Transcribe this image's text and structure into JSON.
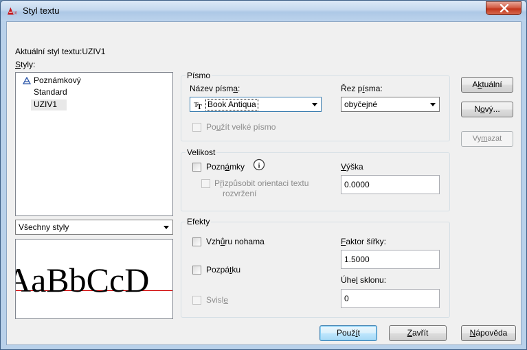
{
  "window": {
    "title": "Styl textu",
    "app_icon_text": "A10"
  },
  "current_style": {
    "label": "Aktuální styl textu:",
    "value": "UZIV1"
  },
  "styles": {
    "label": "Styly:",
    "items": [
      {
        "label": "Poznámkový",
        "annotative": true
      },
      {
        "label": "Standard",
        "annotative": false
      },
      {
        "label": "UZIV1",
        "annotative": false,
        "selected": true
      }
    ],
    "filter_value": "Všechny styly",
    "preview_text": "AaBbCcD"
  },
  "font": {
    "group_title": "Písmo",
    "name_label": "Název písma:",
    "name_value": "Book Antiqua",
    "style_label": "Řez písma:",
    "style_value": "obyčejné",
    "big_font_label": "Použít velké písmo"
  },
  "size": {
    "group_title": "Velikost",
    "annotative_label": "Poznámky",
    "match_orientation_label_1": "Přizpůsobit orientaci textu",
    "match_orientation_label_2": "rozvržení",
    "height_label": "Výška",
    "height_value": "0.0000"
  },
  "effects": {
    "group_title": "Efekty",
    "upside_down_label": "Vzhůru nohama",
    "backwards_label": "Pozpátku",
    "vertical_label": "Svisle",
    "width_factor_label": "Faktor šířky:",
    "width_factor_value": "1.5000",
    "oblique_label": "Úhel sklonu:",
    "oblique_value": "0"
  },
  "buttons": {
    "set_current": "Aktuální",
    "new": "Nový...",
    "delete": "Vymazat",
    "apply": "Použít",
    "close": "Zavřít",
    "help": "Nápověda"
  },
  "colors": {
    "preview_baseline": "#d00000",
    "app_icon": "#c4141a"
  }
}
